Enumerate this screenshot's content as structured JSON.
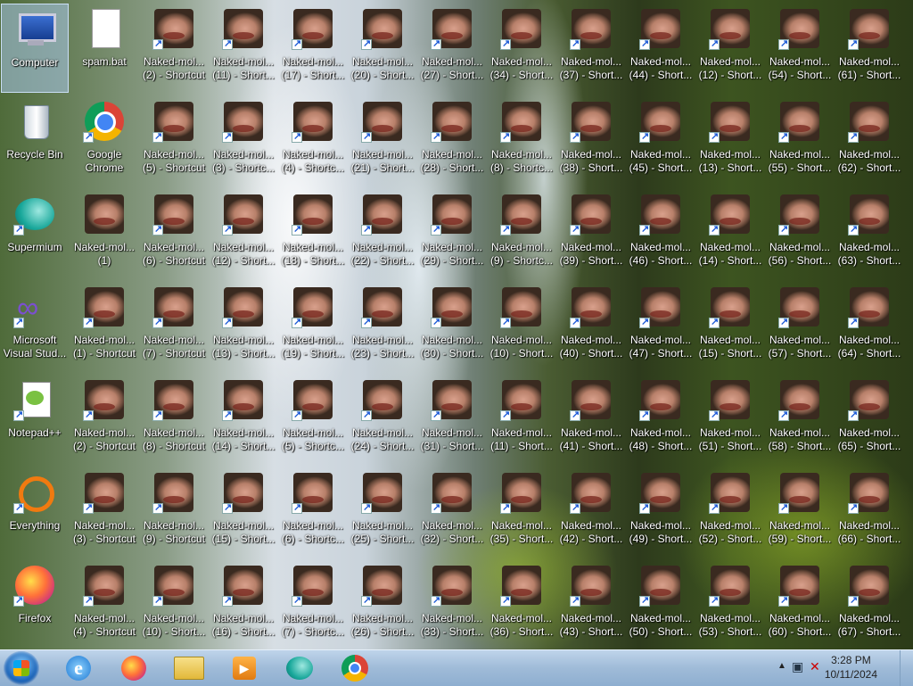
{
  "desktop": {
    "system_icons": [
      {
        "name": "computer-icon",
        "label": "Computer",
        "col": 0,
        "row": 0,
        "selected": true
      },
      {
        "name": "spam-bat-icon",
        "label": "spam.bat",
        "col": 1,
        "row": 0
      },
      {
        "name": "recycle-bin-icon",
        "label": "Recycle Bin",
        "col": 0,
        "row": 1
      },
      {
        "name": "google-chrome-icon",
        "label": "Google Chrome",
        "col": 1,
        "row": 1,
        "shortcut": true
      },
      {
        "name": "supermium-icon",
        "label": "Supermium",
        "col": 0,
        "row": 2,
        "shortcut": true
      },
      {
        "name": "visual-studio-icon",
        "label": "Microsoft Visual Stud...",
        "col": 0,
        "row": 3,
        "shortcut": true
      },
      {
        "name": "notepad-plus-icon",
        "label": "Notepad++",
        "col": 0,
        "row": 4,
        "shortcut": true
      },
      {
        "name": "everything-icon",
        "label": "Everything",
        "col": 0,
        "row": 5,
        "shortcut": true
      },
      {
        "name": "firefox-icon",
        "label": "Firefox",
        "col": 0,
        "row": 6,
        "shortcut": true
      }
    ],
    "shortcuts": [
      {
        "col": 2,
        "row": 0,
        "l1": "Naked-mol...",
        "l2": "(2) - Shortcut"
      },
      {
        "col": 3,
        "row": 0,
        "l1": "Naked-mol...",
        "l2": "(11) - Short..."
      },
      {
        "col": 4,
        "row": 0,
        "l1": "Naked-mol...",
        "l2": "(17) - Short..."
      },
      {
        "col": 5,
        "row": 0,
        "l1": "Naked-mol...",
        "l2": "(20) - Short..."
      },
      {
        "col": 6,
        "row": 0,
        "l1": "Naked-mol...",
        "l2": "(27) - Short..."
      },
      {
        "col": 7,
        "row": 0,
        "l1": "Naked-mol...",
        "l2": "(34) - Short..."
      },
      {
        "col": 8,
        "row": 0,
        "l1": "Naked-mol...",
        "l2": "(37) - Short..."
      },
      {
        "col": 9,
        "row": 0,
        "l1": "Naked-mol...",
        "l2": "(44) - Short..."
      },
      {
        "col": 10,
        "row": 0,
        "l1": "Naked-mol...",
        "l2": "(12) - Short..."
      },
      {
        "col": 11,
        "row": 0,
        "l1": "Naked-mol...",
        "l2": "(54) - Short..."
      },
      {
        "col": 12,
        "row": 0,
        "l1": "Naked-mol...",
        "l2": "(61) - Short..."
      },
      {
        "col": 2,
        "row": 1,
        "l1": "Naked-mol...",
        "l2": "(5) - Shortcut"
      },
      {
        "col": 3,
        "row": 1,
        "l1": "Naked-mol...",
        "l2": "(3) - Shortc..."
      },
      {
        "col": 4,
        "row": 1,
        "l1": "Naked-mol...",
        "l2": "(4) - Shortc..."
      },
      {
        "col": 5,
        "row": 1,
        "l1": "Naked-mol...",
        "l2": "(21) - Short..."
      },
      {
        "col": 6,
        "row": 1,
        "l1": "Naked-mol...",
        "l2": "(28) - Short..."
      },
      {
        "col": 7,
        "row": 1,
        "l1": "Naked-mol...",
        "l2": "(8) - Shortc..."
      },
      {
        "col": 8,
        "row": 1,
        "l1": "Naked-mol...",
        "l2": "(38) - Short..."
      },
      {
        "col": 9,
        "row": 1,
        "l1": "Naked-mol...",
        "l2": "(45) - Short..."
      },
      {
        "col": 10,
        "row": 1,
        "l1": "Naked-mol...",
        "l2": "(13) - Short..."
      },
      {
        "col": 11,
        "row": 1,
        "l1": "Naked-mol...",
        "l2": "(55) - Short..."
      },
      {
        "col": 12,
        "row": 1,
        "l1": "Naked-mol...",
        "l2": "(62) - Short..."
      },
      {
        "col": 1,
        "row": 2,
        "l1": "Naked-mol...",
        "l2": "(1)",
        "shortcut": false
      },
      {
        "col": 2,
        "row": 2,
        "l1": "Naked-mol...",
        "l2": "(6) - Shortcut"
      },
      {
        "col": 3,
        "row": 2,
        "l1": "Naked-mol...",
        "l2": "(12) - Short..."
      },
      {
        "col": 4,
        "row": 2,
        "l1": "Naked-mol...",
        "l2": "(18) - Short..."
      },
      {
        "col": 5,
        "row": 2,
        "l1": "Naked-mol...",
        "l2": "(22) - Short..."
      },
      {
        "col": 6,
        "row": 2,
        "l1": "Naked-mol...",
        "l2": "(29) - Short..."
      },
      {
        "col": 7,
        "row": 2,
        "l1": "Naked-mol...",
        "l2": "(9) - Shortc..."
      },
      {
        "col": 8,
        "row": 2,
        "l1": "Naked-mol...",
        "l2": "(39) - Short..."
      },
      {
        "col": 9,
        "row": 2,
        "l1": "Naked-mol...",
        "l2": "(46) - Short..."
      },
      {
        "col": 10,
        "row": 2,
        "l1": "Naked-mol...",
        "l2": "(14) - Short..."
      },
      {
        "col": 11,
        "row": 2,
        "l1": "Naked-mol...",
        "l2": "(56) - Short..."
      },
      {
        "col": 12,
        "row": 2,
        "l1": "Naked-mol...",
        "l2": "(63) - Short..."
      },
      {
        "col": 1,
        "row": 3,
        "l1": "Naked-mol...",
        "l2": "(1) - Shortcut"
      },
      {
        "col": 2,
        "row": 3,
        "l1": "Naked-mol...",
        "l2": "(7) - Shortcut"
      },
      {
        "col": 3,
        "row": 3,
        "l1": "Naked-mol...",
        "l2": "(13) - Short..."
      },
      {
        "col": 4,
        "row": 3,
        "l1": "Naked-mol...",
        "l2": "(19) - Short..."
      },
      {
        "col": 5,
        "row": 3,
        "l1": "Naked-mol...",
        "l2": "(23) - Short..."
      },
      {
        "col": 6,
        "row": 3,
        "l1": "Naked-mol...",
        "l2": "(30) - Short..."
      },
      {
        "col": 7,
        "row": 3,
        "l1": "Naked-mol...",
        "l2": "(10) - Short..."
      },
      {
        "col": 8,
        "row": 3,
        "l1": "Naked-mol...",
        "l2": "(40) - Short..."
      },
      {
        "col": 9,
        "row": 3,
        "l1": "Naked-mol...",
        "l2": "(47) - Short..."
      },
      {
        "col": 10,
        "row": 3,
        "l1": "Naked-mol...",
        "l2": "(15) - Short..."
      },
      {
        "col": 11,
        "row": 3,
        "l1": "Naked-mol...",
        "l2": "(57) - Short..."
      },
      {
        "col": 12,
        "row": 3,
        "l1": "Naked-mol...",
        "l2": "(64) - Short..."
      },
      {
        "col": 1,
        "row": 4,
        "l1": "Naked-mol...",
        "l2": "(2) - Shortcut"
      },
      {
        "col": 2,
        "row": 4,
        "l1": "Naked-mol...",
        "l2": "(8) - Shortcut"
      },
      {
        "col": 3,
        "row": 4,
        "l1": "Naked-mol...",
        "l2": "(14) - Short..."
      },
      {
        "col": 4,
        "row": 4,
        "l1": "Naked-mol...",
        "l2": "(5) - Shortc..."
      },
      {
        "col": 5,
        "row": 4,
        "l1": "Naked-mol...",
        "l2": "(24) - Short..."
      },
      {
        "col": 6,
        "row": 4,
        "l1": "Naked-mol...",
        "l2": "(31) - Short..."
      },
      {
        "col": 7,
        "row": 4,
        "l1": "Naked-mol...",
        "l2": "(11) - Short..."
      },
      {
        "col": 8,
        "row": 4,
        "l1": "Naked-mol...",
        "l2": "(41) - Short..."
      },
      {
        "col": 9,
        "row": 4,
        "l1": "Naked-mol...",
        "l2": "(48) - Short..."
      },
      {
        "col": 10,
        "row": 4,
        "l1": "Naked-mol...",
        "l2": "(51) - Short..."
      },
      {
        "col": 11,
        "row": 4,
        "l1": "Naked-mol...",
        "l2": "(58) - Short..."
      },
      {
        "col": 12,
        "row": 4,
        "l1": "Naked-mol...",
        "l2": "(65) - Short..."
      },
      {
        "col": 1,
        "row": 5,
        "l1": "Naked-mol...",
        "l2": "(3) - Shortcut"
      },
      {
        "col": 2,
        "row": 5,
        "l1": "Naked-mol...",
        "l2": "(9) - Shortcut"
      },
      {
        "col": 3,
        "row": 5,
        "l1": "Naked-mol...",
        "l2": "(15) - Short..."
      },
      {
        "col": 4,
        "row": 5,
        "l1": "Naked-mol...",
        "l2": "(6) - Shortc..."
      },
      {
        "col": 5,
        "row": 5,
        "l1": "Naked-mol...",
        "l2": "(25) - Short..."
      },
      {
        "col": 6,
        "row": 5,
        "l1": "Naked-mol...",
        "l2": "(32) - Short..."
      },
      {
        "col": 7,
        "row": 5,
        "l1": "Naked-mol...",
        "l2": "(35) - Short..."
      },
      {
        "col": 8,
        "row": 5,
        "l1": "Naked-mol...",
        "l2": "(42) - Short..."
      },
      {
        "col": 9,
        "row": 5,
        "l1": "Naked-mol...",
        "l2": "(49) - Short..."
      },
      {
        "col": 10,
        "row": 5,
        "l1": "Naked-mol...",
        "l2": "(52) - Short..."
      },
      {
        "col": 11,
        "row": 5,
        "l1": "Naked-mol...",
        "l2": "(59) - Short..."
      },
      {
        "col": 12,
        "row": 5,
        "l1": "Naked-mol...",
        "l2": "(66) - Short..."
      },
      {
        "col": 1,
        "row": 6,
        "l1": "Naked-mol...",
        "l2": "(4) - Shortcut"
      },
      {
        "col": 2,
        "row": 6,
        "l1": "Naked-mol...",
        "l2": "(10) - Short..."
      },
      {
        "col": 3,
        "row": 6,
        "l1": "Naked-mol...",
        "l2": "(16) - Short..."
      },
      {
        "col": 4,
        "row": 6,
        "l1": "Naked-mol...",
        "l2": "(7) - Shortc..."
      },
      {
        "col": 5,
        "row": 6,
        "l1": "Naked-mol...",
        "l2": "(26) - Short..."
      },
      {
        "col": 6,
        "row": 6,
        "l1": "Naked-mol...",
        "l2": "(33) - Short..."
      },
      {
        "col": 7,
        "row": 6,
        "l1": "Naked-mol...",
        "l2": "(36) - Short..."
      },
      {
        "col": 8,
        "row": 6,
        "l1": "Naked-mol...",
        "l2": "(43) - Short..."
      },
      {
        "col": 9,
        "row": 6,
        "l1": "Naked-mol...",
        "l2": "(50) - Short..."
      },
      {
        "col": 10,
        "row": 6,
        "l1": "Naked-mol...",
        "l2": "(53) - Short..."
      },
      {
        "col": 11,
        "row": 6,
        "l1": "Naked-mol...",
        "l2": "(60) - Short..."
      },
      {
        "col": 12,
        "row": 6,
        "l1": "Naked-mol...",
        "l2": "(67) - Short..."
      }
    ]
  },
  "taskbar": {
    "pinned": [
      {
        "name": "internet-explorer-icon"
      },
      {
        "name": "firefox-icon"
      },
      {
        "name": "file-explorer-icon"
      },
      {
        "name": "media-player-icon"
      },
      {
        "name": "supermium-icon"
      },
      {
        "name": "chrome-icon"
      }
    ],
    "clock": {
      "time": "3:28 PM",
      "date": "10/11/2024"
    }
  },
  "colors": {
    "taskbar": "#9fbbd8",
    "label_text": "#ffffff",
    "selection": "#aac8eb"
  }
}
